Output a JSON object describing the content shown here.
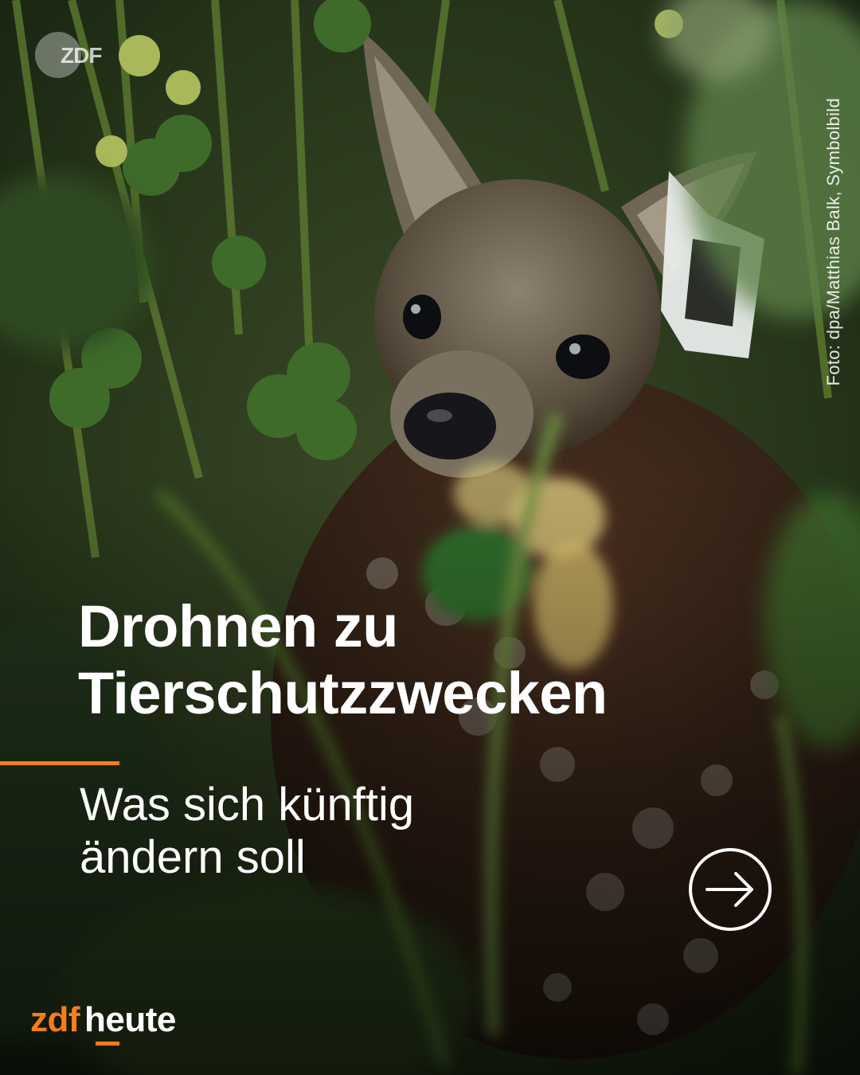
{
  "image": {
    "description_icon": "fawn-in-clover-photo",
    "corner_logo": "ZDF"
  },
  "credit": "Foto: dpa/Matthias Balk, Symbolbild",
  "headline": {
    "line1": "Drohnen zu",
    "line2": "Tierschutzzwecken"
  },
  "subline": {
    "line1": "Was sich künftig",
    "line2": "ändern soll"
  },
  "next_icon": "arrow-right-circle-icon",
  "brand": {
    "zdf": "zdf",
    "heute": "heute"
  },
  "colors": {
    "accent": "#fa7d19",
    "text": "#ffffff"
  }
}
